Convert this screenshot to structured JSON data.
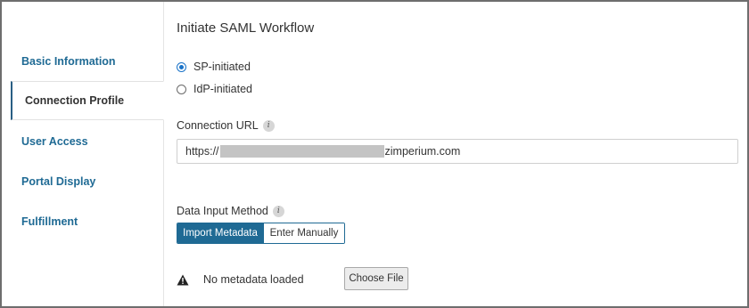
{
  "sidebar": {
    "items": [
      {
        "label": "Basic Information",
        "active": false
      },
      {
        "label": "Connection Profile",
        "active": true
      },
      {
        "label": "User Access",
        "active": false
      },
      {
        "label": "Portal Display",
        "active": false
      },
      {
        "label": "Fulfillment",
        "active": false
      }
    ]
  },
  "main": {
    "title": "Initiate SAML Workflow",
    "workflow_options": [
      {
        "label": "SP-initiated",
        "selected": true
      },
      {
        "label": "IdP-initiated",
        "selected": false
      }
    ],
    "connection_url": {
      "label": "Connection URL",
      "info_icon": "i",
      "value_prefix": "https://",
      "value_suffix": "zimperium.com"
    },
    "data_input_method": {
      "label": "Data Input Method",
      "info_icon": "i",
      "options": [
        "Import Metadata",
        "Enter Manually"
      ],
      "selected": "Import Metadata"
    },
    "metadata_status": {
      "icon": "warning-icon",
      "text": "No metadata loaded"
    },
    "choose_file_label": "Choose File"
  },
  "colors": {
    "accent": "#1f6a94",
    "radio_selected": "#1a73c8",
    "text": "#333333"
  }
}
